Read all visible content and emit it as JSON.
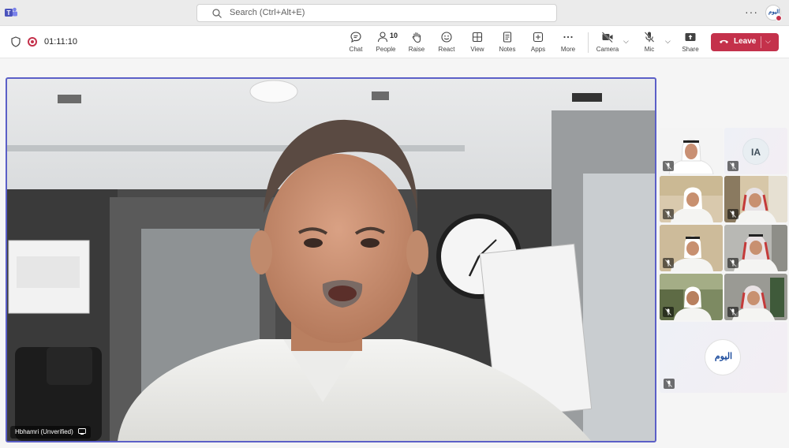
{
  "titlebar": {
    "search_placeholder": "Search (Ctrl+Alt+E)",
    "more_label": "···",
    "avatar_text": "اليوم"
  },
  "meeting": {
    "elapsed": "01:11:10",
    "people_count": "10",
    "tools": {
      "chat": "Chat",
      "people": "People",
      "raise": "Raise",
      "react": "React",
      "view": "View",
      "notes": "Notes",
      "apps": "Apps",
      "more": "More",
      "camera": "Camera",
      "mic": "Mic",
      "share": "Share"
    },
    "leave_label": "Leave"
  },
  "stage": {
    "speaker_name": "Hbhamri (Unverified)"
  },
  "gallery": {
    "initials_tile": "IA",
    "logo_text": "اليوم"
  },
  "colors": {
    "accent": "#5b5fc7",
    "leave": "#c4314b"
  }
}
